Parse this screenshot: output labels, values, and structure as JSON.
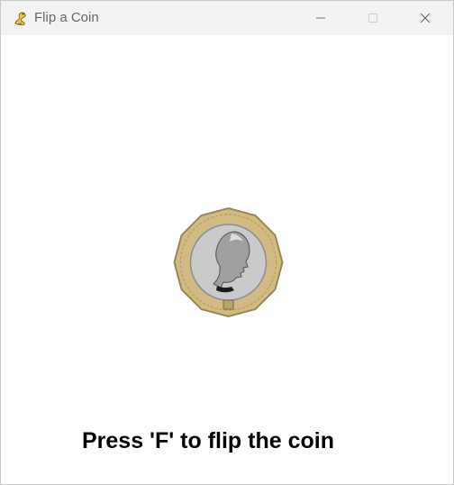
{
  "window": {
    "title": "Flip a Coin",
    "app_icon": "pygame-snake-icon",
    "controls": [
      "minimize-icon",
      "maximize-icon",
      "close-icon"
    ]
  },
  "main": {
    "coin_image": "one-pound-coin",
    "instruction": "Press 'F' to flip the coin"
  },
  "colors": {
    "titlebar_bg": "#f3f3f3",
    "content_bg": "#ffffff",
    "text": "#000000",
    "coin_outer_gold": "#c9b27a",
    "coin_inner_silver": "#c6c7c8"
  }
}
